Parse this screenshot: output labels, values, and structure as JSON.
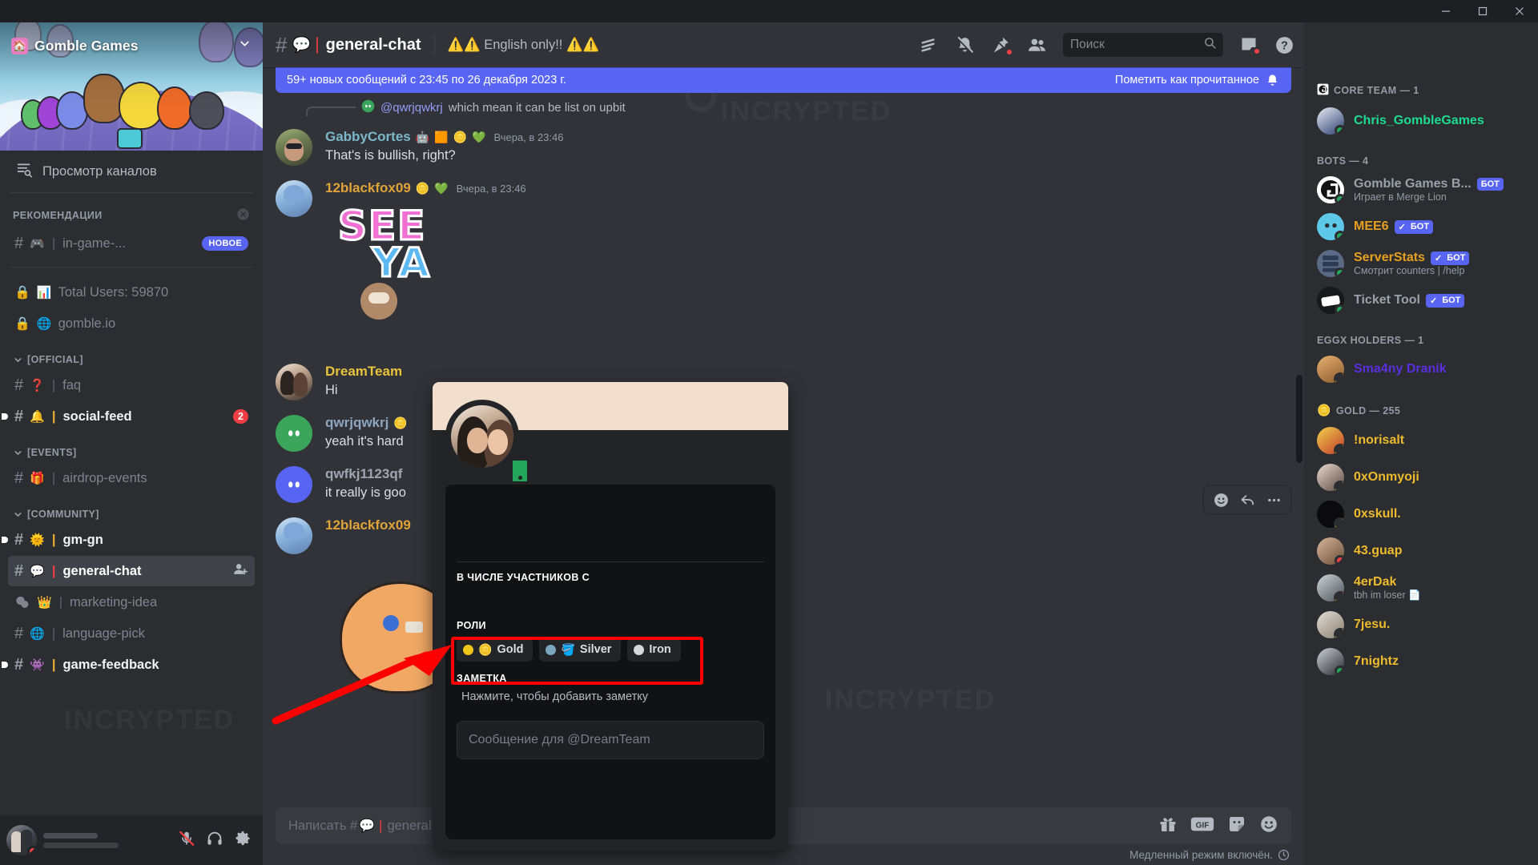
{
  "window": {
    "minimize": "—",
    "maximize": "□",
    "close": "✕"
  },
  "server": {
    "name": "Gomble Games",
    "home_emoji": "🏠",
    "browse_channels": "Просмотр каналов"
  },
  "sidebar": {
    "recommendations_header": "РЕКОМЕНДАЦИИ",
    "recommended": {
      "emoji": "🎮",
      "name": "in-game-...",
      "badge": "НОВОЕ"
    },
    "pinned": [
      {
        "emoji": "📊",
        "name": "Total Users: 59870",
        "locked": true
      },
      {
        "emoji": "🌐",
        "name": "gomble.io",
        "locked": true
      }
    ],
    "categories": [
      {
        "label": "[OFFICIAL]",
        "channels": [
          {
            "emoji": "❓",
            "name": "faq",
            "state": "read",
            "badge": ""
          },
          {
            "emoji": "🔔",
            "name": "social-feed",
            "state": "unread",
            "badge": "2"
          }
        ]
      },
      {
        "label": "[EVENTS]",
        "channels": [
          {
            "emoji": "🎁",
            "name": "airdrop-events",
            "state": "read",
            "badge": ""
          }
        ]
      },
      {
        "label": "[COMMUNITY]",
        "channels": [
          {
            "emoji": "🌞",
            "name": "gm-gn",
            "state": "unread",
            "badge": ""
          },
          {
            "emoji": "💬",
            "name": "general-chat",
            "state": "active",
            "badge": ""
          },
          {
            "emoji": "👑",
            "name": "marketing-idea",
            "state": "read",
            "badge": "",
            "voice": true
          },
          {
            "emoji": "🌐",
            "name": "language-pick",
            "state": "read",
            "badge": ""
          },
          {
            "emoji": "👾",
            "name": "game-feedback",
            "state": "unread",
            "badge": ""
          }
        ]
      }
    ]
  },
  "header": {
    "channel_emoji": "💬",
    "channel_name": "general-chat",
    "topic": "⚠️⚠️ English only!! ⚠️⚠️",
    "icons": [
      "threads-icon",
      "bell-off-icon",
      "pin-icon",
      "members-icon"
    ],
    "search_placeholder": "Поиск",
    "inbox_icon": "inbox-icon",
    "help_icon": "help-icon"
  },
  "banner": {
    "text": "59+ новых сообщений с 23:45 по 26 декабря 2023 г.",
    "action": "Пометить как прочитанное"
  },
  "messages": [
    {
      "reply_to": "@qwrjqwkrj",
      "reply_text": "which mean it can be list on upbit",
      "author": "GabbyCortes",
      "author_color": "gabby",
      "badges": [
        "🤖",
        "🟧",
        "🪙",
        "💚"
      ],
      "timestamp": "Вчера, в 23:46",
      "text": "That's is bullish, right?"
    },
    {
      "author": "12blackfox09",
      "author_color": "blackfox",
      "badges": [
        "🪙",
        "💚"
      ],
      "timestamp": "Вчера, в 23:46",
      "sticker": "see-ya-sticker"
    },
    {
      "author": "DreamTeam",
      "author_color": "dream",
      "badges": [],
      "timestamp": "",
      "text": "Hi"
    },
    {
      "author": "qwrjqwkrj",
      "author_color": "qwrj",
      "badges": [
        "🪙"
      ],
      "timestamp": "",
      "text": "yeah it's hard"
    },
    {
      "author": "qwfkj1123qf",
      "author_color": "qwfkj",
      "badges": [],
      "timestamp": "",
      "text": "it really is goo"
    },
    {
      "author": "12blackfox09",
      "author_color": "blackfox",
      "badges": [],
      "timestamp": "",
      "sticker": "bird-sticker"
    }
  ],
  "message_toolbar": {
    "emoji": "add-reaction-icon",
    "reply": "reply-icon",
    "more": "more-icon"
  },
  "composer": {
    "prefix": "Написать #",
    "emoji": "💬",
    "channel": "general-chat",
    "icons": [
      "gift-icon",
      "GIF",
      "sticker-icon",
      "emoji-icon"
    ],
    "slowmode": "Медленный режим включён."
  },
  "profile": {
    "member_since_label": "В ЧИСЛЕ УЧАСТНИКОВ С",
    "roles_label": "РОЛИ",
    "roles": [
      {
        "name": "Gold",
        "color": "#f0c419",
        "emoji": "🪙"
      },
      {
        "name": "Silver",
        "color": "#7ba6bd",
        "emoji": "🪣"
      },
      {
        "name": "Iron",
        "color": "#d5d7da",
        "emoji": ""
      }
    ],
    "note_label": "ЗАМЕТКА",
    "note_placeholder": "Нажмите, чтобы добавить заметку",
    "message_placeholder": "Сообщение для @DreamTeam",
    "status_icon": "mobile-icon"
  },
  "members": {
    "groups": [
      {
        "label": "CORE TEAM — 1",
        "emoji": "⚫",
        "rows": [
          {
            "name": "Chris_GombleGames",
            "color": "nm-green",
            "status": "online",
            "sub": "",
            "bot": false,
            "verified": false,
            "avatar": "chris"
          }
        ]
      },
      {
        "label": "BOTS — 4",
        "emoji": "",
        "rows": [
          {
            "name": "Gomble Games B...",
            "color": "nm-grey",
            "status": "online",
            "sub": "Играет в Merge Lion",
            "bot": true,
            "verified": false,
            "avatar": "gomble"
          },
          {
            "name": "MEE6",
            "color": "nm-orange",
            "status": "online",
            "sub": "",
            "bot": true,
            "verified": true,
            "avatar": "mee6"
          },
          {
            "name": "ServerStats",
            "color": "nm-orange",
            "status": "online",
            "sub": "Смотрит counters | /help",
            "bot": true,
            "verified": true,
            "avatar": "serverstats"
          },
          {
            "name": "Ticket Tool",
            "color": "nm-grey",
            "status": "online",
            "sub": "",
            "bot": true,
            "verified": true,
            "avatar": "ticket"
          }
        ]
      },
      {
        "label": "EGGX HOLDERS — 1",
        "emoji": "",
        "rows": [
          {
            "name": "Sma4ny Dranik",
            "color": "nm-purple",
            "status": "idle",
            "sub": "",
            "bot": false,
            "verified": false,
            "avatar": "dranik"
          }
        ]
      },
      {
        "label": "GOLD — 255",
        "emoji": "🪙",
        "rows": [
          {
            "name": "!norisalt",
            "color": "nm-gold",
            "status": "idle",
            "sub": "",
            "bot": false,
            "verified": false,
            "avatar": "norisalt"
          },
          {
            "name": "0xOnmyoji",
            "color": "nm-gold",
            "status": "idle",
            "sub": "",
            "bot": false,
            "verified": false,
            "avatar": "onmyoji"
          },
          {
            "name": "0xskull.",
            "color": "nm-gold",
            "status": "idle",
            "sub": "",
            "bot": false,
            "verified": false,
            "avatar": "skull"
          },
          {
            "name": "43.guap",
            "color": "nm-gold",
            "status": "dnd",
            "sub": "",
            "bot": false,
            "verified": false,
            "avatar": "guap"
          },
          {
            "name": "4erDak",
            "color": "nm-gold",
            "status": "idle",
            "sub": "tbh im loser 📄",
            "bot": false,
            "verified": false,
            "avatar": "dak"
          },
          {
            "name": "7jesu.",
            "color": "nm-gold",
            "status": "idle",
            "sub": "",
            "bot": false,
            "verified": false,
            "avatar": "jesu"
          },
          {
            "name": "7nightz",
            "color": "nm-gold",
            "status": "online",
            "sub": "",
            "bot": false,
            "verified": false,
            "avatar": "nightz"
          }
        ]
      }
    ],
    "bot_tag": "БОТ"
  },
  "watermark": "INCRYPTED"
}
